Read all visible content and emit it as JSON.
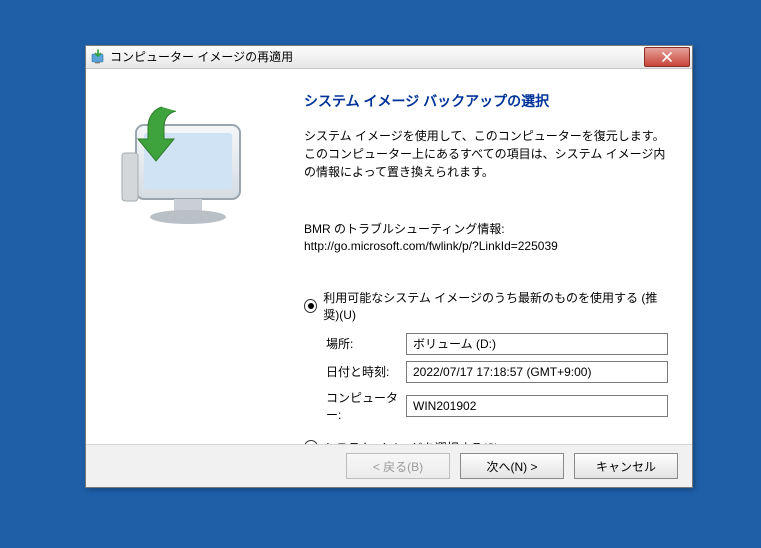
{
  "window": {
    "title": "コンピューター イメージの再適用"
  },
  "heading": "システム イメージ バックアップの選択",
  "description": "システム イメージを使用して、このコンピューターを復元します。このコンピューター上にあるすべての項目は、システム イメージ内の情報によって置き換えられます。",
  "troubleshoot": {
    "label": "BMR のトラブルシューティング情報:",
    "url": "http://go.microsoft.com/fwlink/p/?LinkId=225039"
  },
  "radio": {
    "useLatest": "利用可能なシステム イメージのうち最新のものを使用する (推奨)(U)",
    "selectImage": "システム イメージを選択する(S)"
  },
  "fields": {
    "locationLabel": "場所:",
    "locationValue": "ボリューム (D:)",
    "datetimeLabel": "日付と時刻:",
    "datetimeValue": "2022/07/17 17:18:57 (GMT+9:00)",
    "computerLabel": "コンピューター:",
    "computerValue": "WIN201902"
  },
  "buttons": {
    "back": "< 戻る(B)",
    "next": "次へ(N) >",
    "cancel": "キャンセル"
  }
}
